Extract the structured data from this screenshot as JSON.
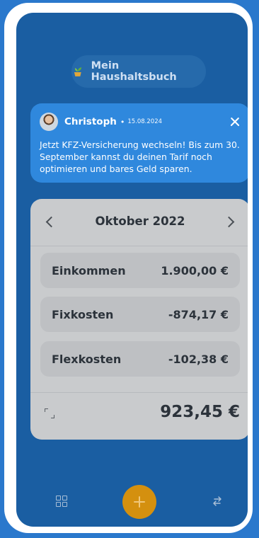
{
  "header": {
    "app_title": "Mein Haushaltsbuch",
    "logo_icon": "sprout-icon"
  },
  "notification": {
    "author": "Christoph",
    "separator": "•",
    "date": "15.08.2024",
    "message": "Jetzt KFZ-Versicherung wechseln! Bis zum 30. September kannst du deinen Tarif noch optimieren und bares Geld sparen."
  },
  "budget": {
    "month": "Oktober 2022",
    "rows": [
      {
        "label": "Einkommen",
        "value": "1.900,00 €"
      },
      {
        "label": "Fixkosten",
        "value": "-874,17 €"
      },
      {
        "label": "Flexkosten",
        "value": "-102,38 €"
      }
    ],
    "total": "923,45 €"
  },
  "bottom_nav": {
    "left_icon": "grid-icon",
    "center_icon": "plus-icon",
    "right_icon": "swap-arrows-icon"
  },
  "colors": {
    "background": "#2a78cc",
    "screen": "#1a5ea2",
    "notification": "#2f88dd",
    "card": "#c9cbcd",
    "accent": "#d4900f"
  }
}
